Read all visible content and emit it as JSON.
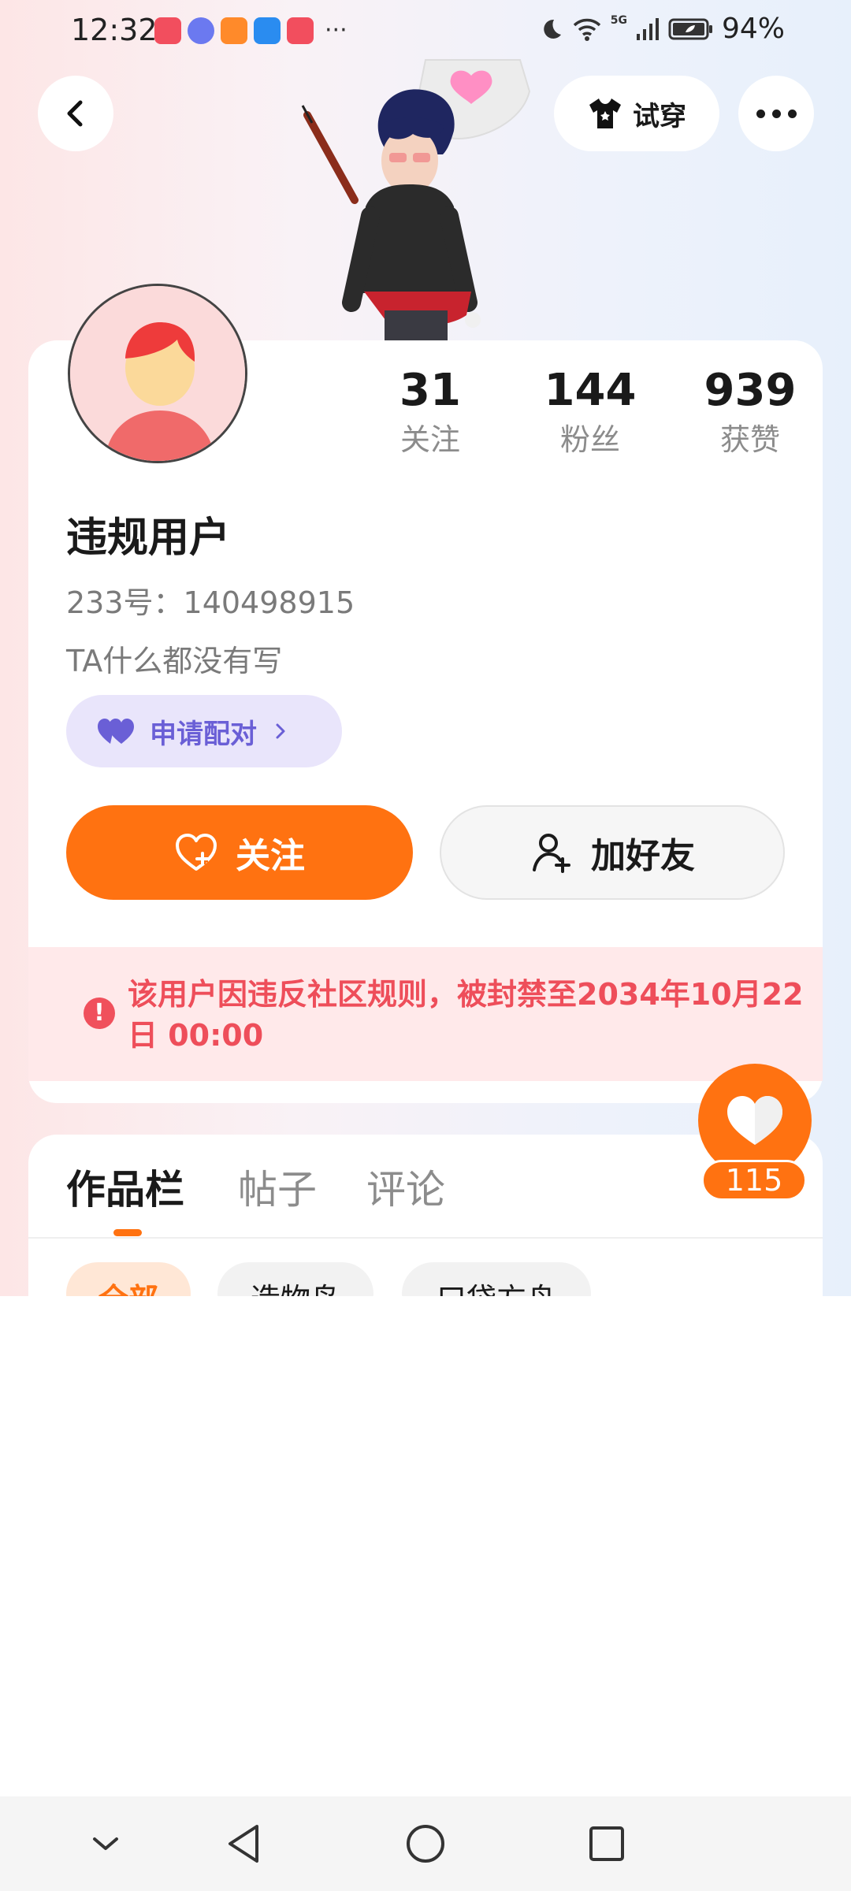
{
  "status_bar": {
    "time": "12:32",
    "more_indicator": "···",
    "battery_percent": "94%",
    "network": "5G"
  },
  "header": {
    "tryon_label": "试穿"
  },
  "profile": {
    "stats": [
      {
        "value": "31",
        "label": "关注"
      },
      {
        "value": "144",
        "label": "粉丝"
      },
      {
        "value": "939",
        "label": "获赞"
      }
    ],
    "username": "违规用户",
    "user_id": "233号：140498915",
    "bio": "TA什么都没有写",
    "pair_label": "申请配对"
  },
  "actions": {
    "follow_label": "关注",
    "add_friend_label": "加好友"
  },
  "ban_notice": {
    "text": "该用户因违反社区规则，被封禁至2034年10月22日 00:00"
  },
  "tabs": {
    "items": [
      "作品栏",
      "帖子",
      "评论"
    ],
    "active_index": 0
  },
  "filters": {
    "chips": [
      "全部",
      "造物岛",
      "口袋方舟"
    ],
    "active_index": 0
  },
  "like_fab": {
    "count": "115"
  },
  "colors": {
    "accent": "#ff7211",
    "ban_text": "#ee4e5a",
    "ban_bg": "#ffe9ea",
    "pair_bg": "#e9e5fb",
    "pair_text": "#6a5fd6"
  },
  "icons": {
    "back": "chevron-left-icon",
    "tryon": "tshirt-icon",
    "more": "more-horizontal-icon",
    "pair": "heart-pair-icon",
    "follow": "heart-plus-icon",
    "add_friend": "user-plus-icon",
    "ban": "alert-icon",
    "like": "heart-icon"
  }
}
